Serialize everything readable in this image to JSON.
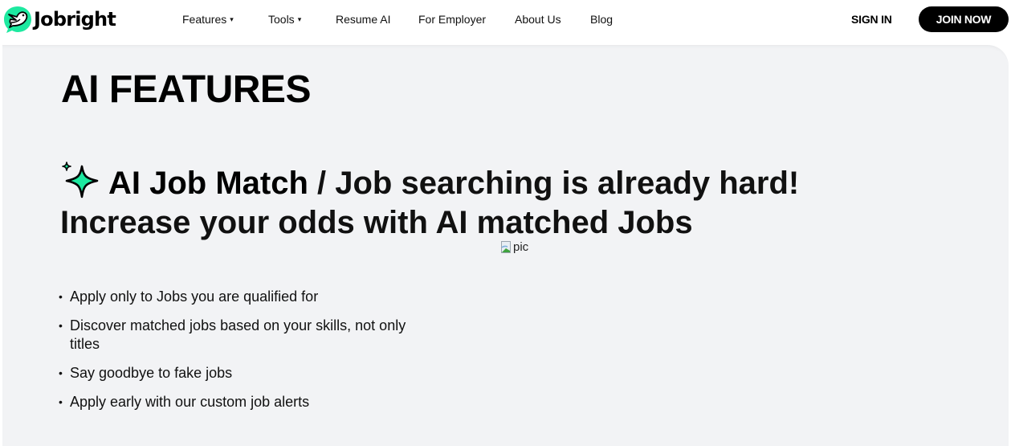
{
  "brand": {
    "name": "Jobright",
    "accent_color": "#1de9a0"
  },
  "nav": {
    "items": [
      {
        "label": "Features",
        "has_dropdown": true
      },
      {
        "label": "Tools",
        "has_dropdown": true
      },
      {
        "label": "Resume AI",
        "has_dropdown": false
      },
      {
        "label": "For Employer",
        "has_dropdown": false
      },
      {
        "label": "About Us",
        "has_dropdown": false
      },
      {
        "label": "Blog",
        "has_dropdown": false
      }
    ],
    "dropdown_caret": "▾",
    "sign_in_label": "SIGN IN",
    "join_now_label": "JOIN NOW"
  },
  "main": {
    "title": "AI FEATURES",
    "feature": {
      "icon": "sparkle-icon",
      "name": "AI Job Match",
      "separator": " / ",
      "tagline": "Job searching is already hard! Increase your odds with AI matched Jobs",
      "image_alt": "pic",
      "bullets": [
        "Apply only to Jobs you are qualified for",
        "Discover matched jobs based on your skills, not only titles",
        "Say goodbye to fake jobs",
        "Apply early with our custom job alerts"
      ]
    }
  }
}
